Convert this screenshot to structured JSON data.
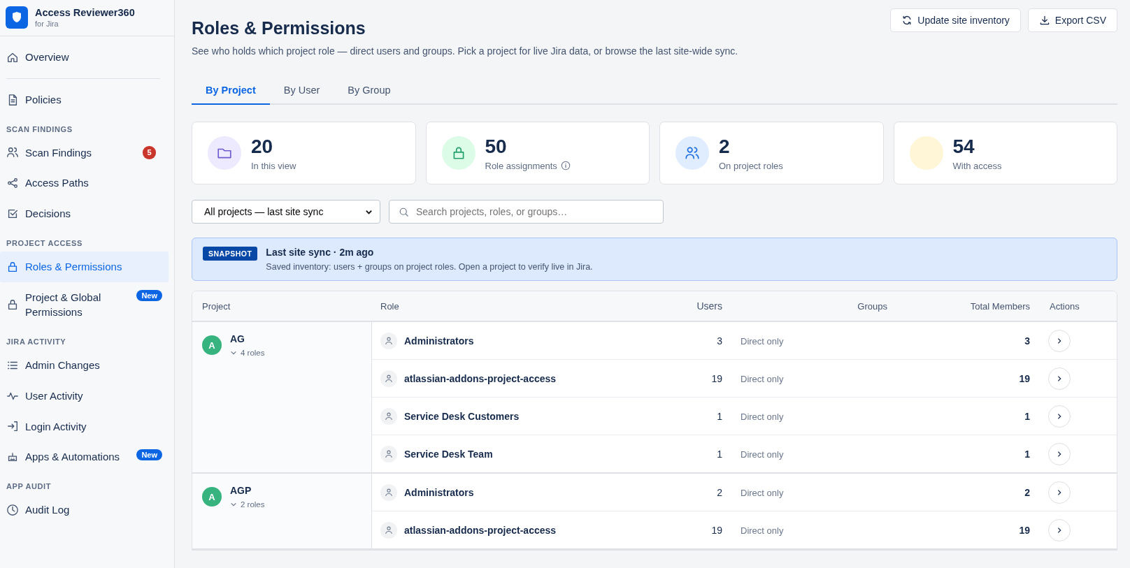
{
  "brand": {
    "name": "Access Reviewer360",
    "subtitle": "for Jira"
  },
  "nav": [
    {
      "kind": "item",
      "label": "Overview",
      "selected": false
    },
    {
      "kind": "divider"
    },
    {
      "kind": "item",
      "label": "Policies",
      "selected": false
    },
    {
      "kind": "section",
      "label": "SCAN FINDINGS"
    },
    {
      "kind": "item",
      "label": "Scan Findings",
      "selected": false,
      "count": "5"
    },
    {
      "kind": "item",
      "label": "Access Paths",
      "selected": false
    },
    {
      "kind": "item",
      "label": "Decisions",
      "selected": false
    },
    {
      "kind": "section",
      "label": "PROJECT ACCESS"
    },
    {
      "kind": "item",
      "label": "Roles & Permissions",
      "selected": true
    },
    {
      "kind": "item",
      "label": "Project & Global Permissions",
      "selected": false,
      "badge": "New"
    },
    {
      "kind": "section",
      "label": "JIRA ACTIVITY"
    },
    {
      "kind": "item",
      "label": "Admin Changes",
      "selected": false
    },
    {
      "kind": "item",
      "label": "User Activity",
      "selected": false
    },
    {
      "kind": "item",
      "label": "Login Activity",
      "selected": false
    },
    {
      "kind": "item",
      "label": "Apps & Automations",
      "selected": false,
      "badge": "New"
    },
    {
      "kind": "section",
      "label": "APP AUDIT"
    },
    {
      "kind": "item",
      "label": "Audit Log",
      "selected": false
    }
  ],
  "page": {
    "title": "Roles & Permissions",
    "subtitle": "See who holds which project role — direct users and groups. Pick a project for live Jira data, or browse the last site-wide sync."
  },
  "actions": [
    {
      "label": "Update site inventory"
    },
    {
      "label": "Export CSV"
    }
  ],
  "tabs": [
    {
      "label": "By Project",
      "selected": true
    },
    {
      "label": "By User",
      "selected": false
    },
    {
      "label": "By Group",
      "selected": false
    }
  ],
  "stats": [
    {
      "color": "#ede9fe",
      "value": "20",
      "label": "In this view"
    },
    {
      "color": "#dcfce7",
      "value": "50",
      "label": "Role assignments",
      "info": true
    },
    {
      "color": "#e0ecff",
      "value": "2",
      "label": "On project roles"
    },
    {
      "color": "#fef6d6",
      "value": "54",
      "label": "With access"
    }
  ],
  "filter": {
    "value": "All projects — last site sync"
  },
  "search": {
    "placeholder": "Search projects, roles, or groups…"
  },
  "banner": {
    "badge": "SNAPSHOT",
    "title": "Last site sync · 2m ago",
    "text": "Saved inventory: users + groups on project roles. Open a project to verify live in Jira."
  },
  "table": {
    "columns": [
      "Project",
      "Role",
      "Users",
      "Groups",
      "Total Members",
      "Actions"
    ],
    "projects": [
      {
        "initial": "A",
        "key": "AG",
        "roles_label": "4 roles",
        "expanded": true,
        "roles": [
          {
            "name": "Administrators",
            "users": "3",
            "groups": "Direct only",
            "total": "3"
          },
          {
            "name": "atlassian-addons-project-access",
            "users": "19",
            "groups": "Direct only",
            "total": "19"
          },
          {
            "name": "Service Desk Customers",
            "users": "1",
            "groups": "Direct only",
            "total": "1"
          },
          {
            "name": "Service Desk Team",
            "users": "1",
            "groups": "Direct only",
            "total": "1"
          }
        ]
      },
      {
        "initial": "A",
        "key": "AGP",
        "roles_label": "2 roles",
        "expanded": true,
        "roles": [
          {
            "name": "Administrators",
            "users": "2",
            "groups": "Direct only",
            "total": "2"
          },
          {
            "name": "atlassian-addons-project-access",
            "users": "19",
            "groups": "Direct only",
            "total": "19"
          }
        ]
      }
    ]
  }
}
